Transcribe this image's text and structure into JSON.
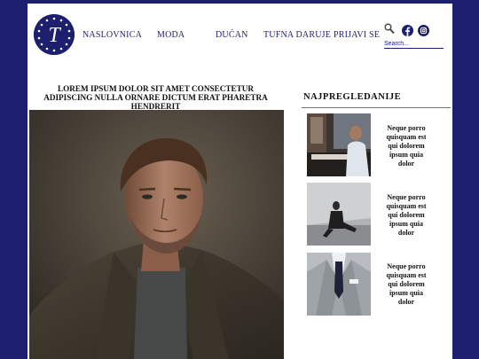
{
  "header": {
    "logo_letter": "T",
    "nav": [
      "NASLOVNICA",
      "MODA",
      "DUĆAN",
      "TUFNA DARUJE",
      "PRIJAVI SE"
    ],
    "search": {
      "placeholder": "Search..."
    },
    "social_icons": [
      "facebook-icon",
      "instagram-icon"
    ]
  },
  "article": {
    "headline": "LOREM IPSUM DOLOR SIT AMET CONSECTETUR ADIPISCING NULLA ORNARE DICTUM ERAT PHARETRA HENDRERIT",
    "image": "man-in-grey-coat-portrait"
  },
  "sidebar": {
    "title": "NAJPREGLEDANIJE",
    "cards": [
      {
        "text": "Neque porro quisquam est qui dolorem ipsum quia dolor",
        "image": "man-playing-piano"
      },
      {
        "text": "Neque porro quisquam est qui dolorem ipsum quia dolor",
        "image": "man-sitting-on-floor"
      },
      {
        "text": "Neque porro quisquam est qui dolorem ipsum quia dolor",
        "image": "suit-and-tie-closeup"
      }
    ]
  },
  "colors": {
    "brand": "#1c1f6e",
    "background": "#ffffff"
  }
}
